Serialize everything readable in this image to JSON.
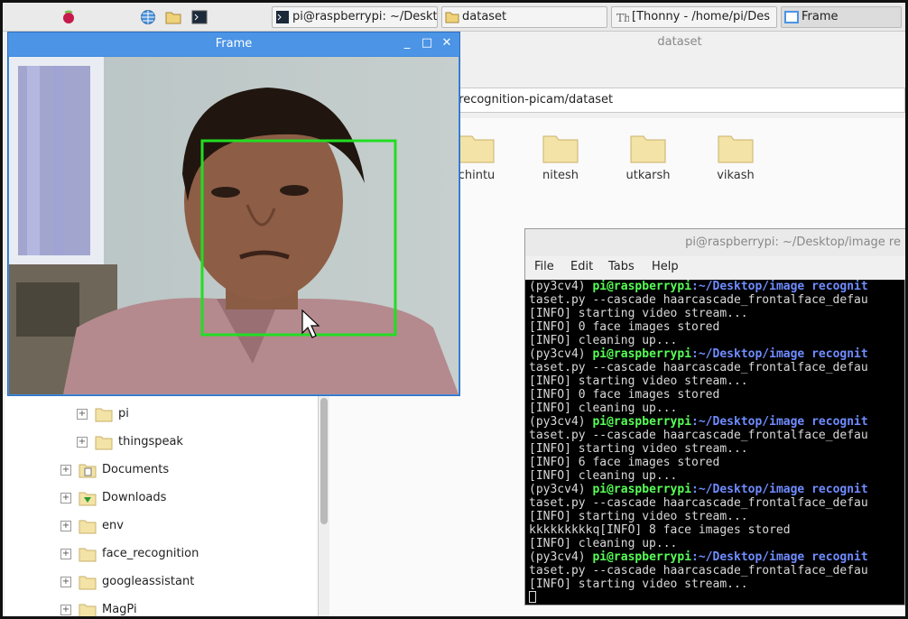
{
  "taskbar": {
    "tasks": [
      {
        "label": "pi@raspberrypi: ~/Deskt"
      },
      {
        "label": "dataset"
      },
      {
        "label": "[Thonny  -  /home/pi/Des"
      },
      {
        "label": "Frame"
      }
    ]
  },
  "file_manager": {
    "title": "dataset",
    "path": "e recognition-picam/dataset",
    "folders": [
      {
        "label": "chintu"
      },
      {
        "label": "nitesh"
      },
      {
        "label": "utkarsh"
      },
      {
        "label": "vikash"
      }
    ],
    "tree": [
      {
        "label": "pi",
        "icon": "folder-icon"
      },
      {
        "label": "thingspeak",
        "icon": "folder-icon"
      },
      {
        "label": "Documents",
        "icon": "documents-folder-icon"
      },
      {
        "label": "Downloads",
        "icon": "downloads-folder-icon"
      },
      {
        "label": "env",
        "icon": "folder-icon"
      },
      {
        "label": "face_recognition",
        "icon": "folder-icon"
      },
      {
        "label": "googleassistant",
        "icon": "folder-icon"
      },
      {
        "label": "MagPi",
        "icon": "folder-icon"
      }
    ],
    "tree_expander": "+"
  },
  "frame_window": {
    "title": "Frame",
    "minimize": "_",
    "maximize": "□",
    "close": "✕"
  },
  "terminal": {
    "title": "pi@raspberrypi: ~/Desktop/image re",
    "menu": [
      "File",
      "Edit",
      "Tabs",
      "Help"
    ],
    "lines": [
      {
        "type": "prompt",
        "env": "(py3cv4) ",
        "user": "pi@raspberrypi",
        "path": ":~/Desktop/image recognit"
      },
      {
        "type": "text",
        "text": "taset.py --cascade haarcascade_frontalface_defau"
      },
      {
        "type": "text",
        "text": "[INFO] starting video stream..."
      },
      {
        "type": "text",
        "text": "[INFO] 0 face images stored"
      },
      {
        "type": "text",
        "text": "[INFO] cleaning up..."
      },
      {
        "type": "prompt",
        "env": "(py3cv4) ",
        "user": "pi@raspberrypi",
        "path": ":~/Desktop/image recognit"
      },
      {
        "type": "text",
        "text": "taset.py --cascade haarcascade_frontalface_defau"
      },
      {
        "type": "text",
        "text": "[INFO] starting video stream..."
      },
      {
        "type": "text",
        "text": "[INFO] 0 face images stored"
      },
      {
        "type": "text",
        "text": "[INFO] cleaning up..."
      },
      {
        "type": "prompt",
        "env": "(py3cv4) ",
        "user": "pi@raspberrypi",
        "path": ":~/Desktop/image recognit"
      },
      {
        "type": "text",
        "text": "taset.py --cascade haarcascade_frontalface_defau"
      },
      {
        "type": "text",
        "text": "[INFO] starting video stream..."
      },
      {
        "type": "text",
        "text": "[INFO] 6 face images stored"
      },
      {
        "type": "text",
        "text": "[INFO] cleaning up..."
      },
      {
        "type": "prompt",
        "env": "(py3cv4) ",
        "user": "pi@raspberrypi",
        "path": ":~/Desktop/image recognit"
      },
      {
        "type": "text",
        "text": "taset.py --cascade haarcascade_frontalface_defau"
      },
      {
        "type": "text",
        "text": "[INFO] starting video stream..."
      },
      {
        "type": "text",
        "text": "kkkkkkkkkq[INFO] 8 face images stored"
      },
      {
        "type": "text",
        "text": "[INFO] cleaning up..."
      },
      {
        "type": "prompt",
        "env": "(py3cv4) ",
        "user": "pi@raspberrypi",
        "path": ":~/Desktop/image recognit"
      },
      {
        "type": "text",
        "text": "taset.py --cascade haarcascade_frontalface_defau"
      },
      {
        "type": "text",
        "text": "[INFO] starting video stream..."
      },
      {
        "type": "cursor"
      }
    ]
  },
  "colors": {
    "detection_box": "#22dd22",
    "title_blue": "#4b94e6",
    "terminal_user": "#57ff57",
    "terminal_path": "#6f8cff"
  }
}
